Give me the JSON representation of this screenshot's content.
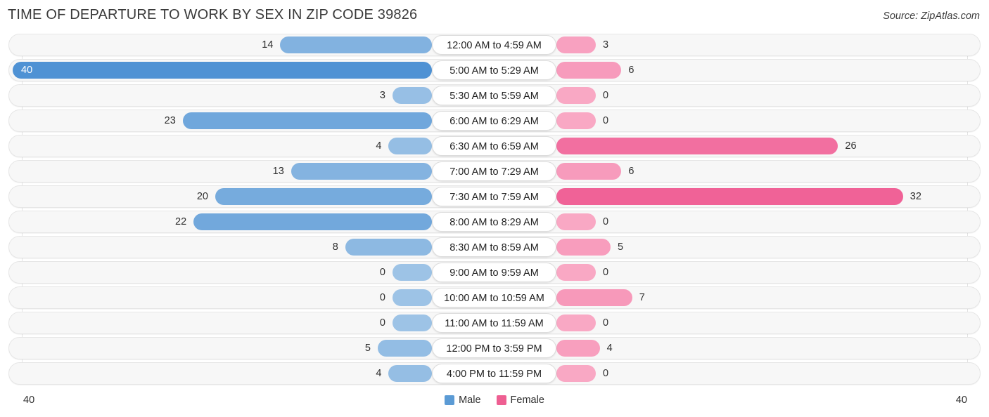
{
  "header": {
    "title": "TIME OF DEPARTURE TO WORK BY SEX IN ZIP CODE 39826",
    "source": "Source: ZipAtlas.com"
  },
  "legend": {
    "male_label": "Male",
    "female_label": "Female",
    "male_color": "#5b9bd5",
    "female_color": "#ee5f92"
  },
  "axis": {
    "left_bound": "40",
    "right_bound": "40"
  },
  "chart_data": {
    "type": "bar",
    "orientation": "horizontal-diverging",
    "title": "TIME OF DEPARTURE TO WORK BY SEX IN ZIP CODE 39826",
    "xlabel": "",
    "ylabel": "",
    "xlim": [
      40,
      40
    ],
    "grid": true,
    "legend_position": "bottom-center",
    "categories": [
      "12:00 AM to 4:59 AM",
      "5:00 AM to 5:29 AM",
      "5:30 AM to 5:59 AM",
      "6:00 AM to 6:29 AM",
      "6:30 AM to 6:59 AM",
      "7:00 AM to 7:29 AM",
      "7:30 AM to 7:59 AM",
      "8:00 AM to 8:29 AM",
      "8:30 AM to 8:59 AM",
      "9:00 AM to 9:59 AM",
      "10:00 AM to 10:59 AM",
      "11:00 AM to 11:59 AM",
      "12:00 PM to 3:59 PM",
      "4:00 PM to 11:59 PM"
    ],
    "series": [
      {
        "name": "Male",
        "values": [
          14,
          40,
          3,
          23,
          4,
          13,
          20,
          22,
          8,
          0,
          0,
          0,
          5,
          4
        ]
      },
      {
        "name": "Female",
        "values": [
          3,
          6,
          0,
          0,
          26,
          6,
          32,
          0,
          5,
          0,
          7,
          0,
          4,
          0
        ]
      }
    ]
  }
}
